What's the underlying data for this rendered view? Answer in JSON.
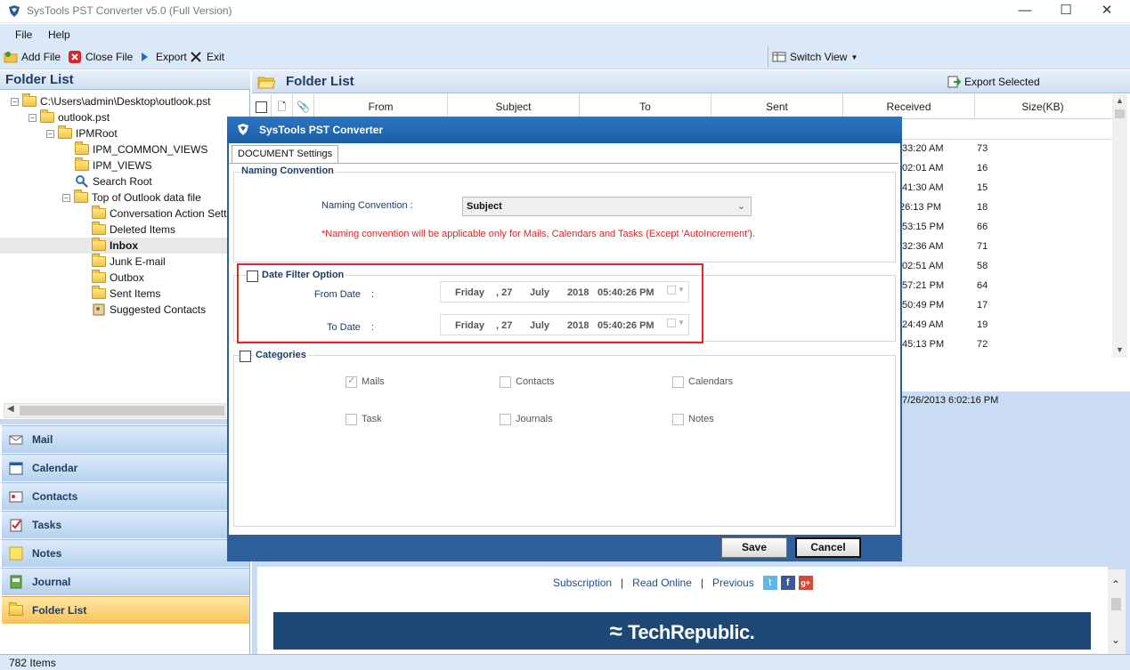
{
  "window": {
    "title": "SysTools  PST Converter v5.0 (Full Version)",
    "minimize": "—",
    "maximize": "☐",
    "close": "✕"
  },
  "menu": {
    "file": "File",
    "help": "Help"
  },
  "toolbar": {
    "add_file": "Add File",
    "close_file": "Close File",
    "export": "Export",
    "exit": "Exit",
    "switch_view": "Switch View"
  },
  "left_panel": {
    "header": "Folder List",
    "tree": [
      {
        "label": "C:\\Users\\admin\\Desktop\\outlook.pst",
        "icon": "folder-open-icon"
      },
      {
        "label": "outlook.pst",
        "icon": "folder-icon"
      },
      {
        "label": "IPMRoot",
        "icon": "folder-icon"
      },
      {
        "label": "IPM_COMMON_VIEWS",
        "icon": "folder-icon"
      },
      {
        "label": "IPM_VIEWS",
        "icon": "folder-icon"
      },
      {
        "label": "Search Root",
        "icon": "search-icon"
      },
      {
        "label": "Top of Outlook data file",
        "icon": "folder-icon"
      },
      {
        "label": "Conversation Action Sett",
        "icon": "folder-icon"
      },
      {
        "label": "Deleted Items",
        "icon": "deleted-items-icon"
      },
      {
        "label": "Inbox",
        "icon": "inbox-icon"
      },
      {
        "label": "Junk E-mail",
        "icon": "junk-icon"
      },
      {
        "label": "Outbox",
        "icon": "outbox-icon"
      },
      {
        "label": "Sent Items",
        "icon": "sent-icon"
      },
      {
        "label": "Suggested Contacts",
        "icon": "contacts-icon"
      }
    ],
    "nav": [
      "Mail",
      "Calendar",
      "Contacts",
      "Tasks",
      "Notes",
      "Journal",
      "Folder List"
    ]
  },
  "right_panel": {
    "header": "Folder List",
    "export_selected": "Export Selected",
    "columns": [
      "From",
      "Subject",
      "To",
      "Sent",
      "Received",
      "Size(KB)"
    ],
    "rows": [
      {
        "received": ":33:20 AM",
        "size": "73"
      },
      {
        "received": ":02:01 AM",
        "size": "16"
      },
      {
        "received": ":41:30 AM",
        "size": "15"
      },
      {
        "received": "26:13 PM",
        "size": "18"
      },
      {
        "received": ":53:15 PM",
        "size": "66"
      },
      {
        "received": ":32:36 AM",
        "size": "71"
      },
      {
        "received": ":02:51 AM",
        "size": "58"
      },
      {
        "received": ":57:21 PM",
        "size": "64"
      },
      {
        "received": ":50:49 PM",
        "size": "17"
      },
      {
        "received": ":24:49 AM",
        "size": "19"
      },
      {
        "received": ":45:13 PM",
        "size": "72"
      }
    ],
    "preview_time": "7/26/2013 6:02:16 PM",
    "links": [
      "Subscription",
      "Read Online",
      "Previous"
    ],
    "banner": "TechRepublic."
  },
  "status": {
    "items": "782 Items"
  },
  "dialog": {
    "title": "SysTools  PST Converter",
    "tab": "DOCUMENT Settings",
    "naming_group": "Naming Convention",
    "naming_label": "Naming Convention :",
    "naming_value": "Subject",
    "naming_note": "*Naming convention will be applicable only for Mails, Calendars and Tasks (Except 'AutoIncrement').",
    "date_filter": "Date Filter Option",
    "from_label": "From Date",
    "to_label": "To Date",
    "colon": ":",
    "date": {
      "day": "Friday",
      "dd": ", 27",
      "month": "July",
      "year": "2018",
      "time": "05:40:26 PM"
    },
    "categories": "Categories",
    "cat_items": [
      "Mails",
      "Contacts",
      "Calendars",
      "Task",
      "Journals",
      "Notes"
    ],
    "save": "Save",
    "cancel": "Cancel"
  }
}
